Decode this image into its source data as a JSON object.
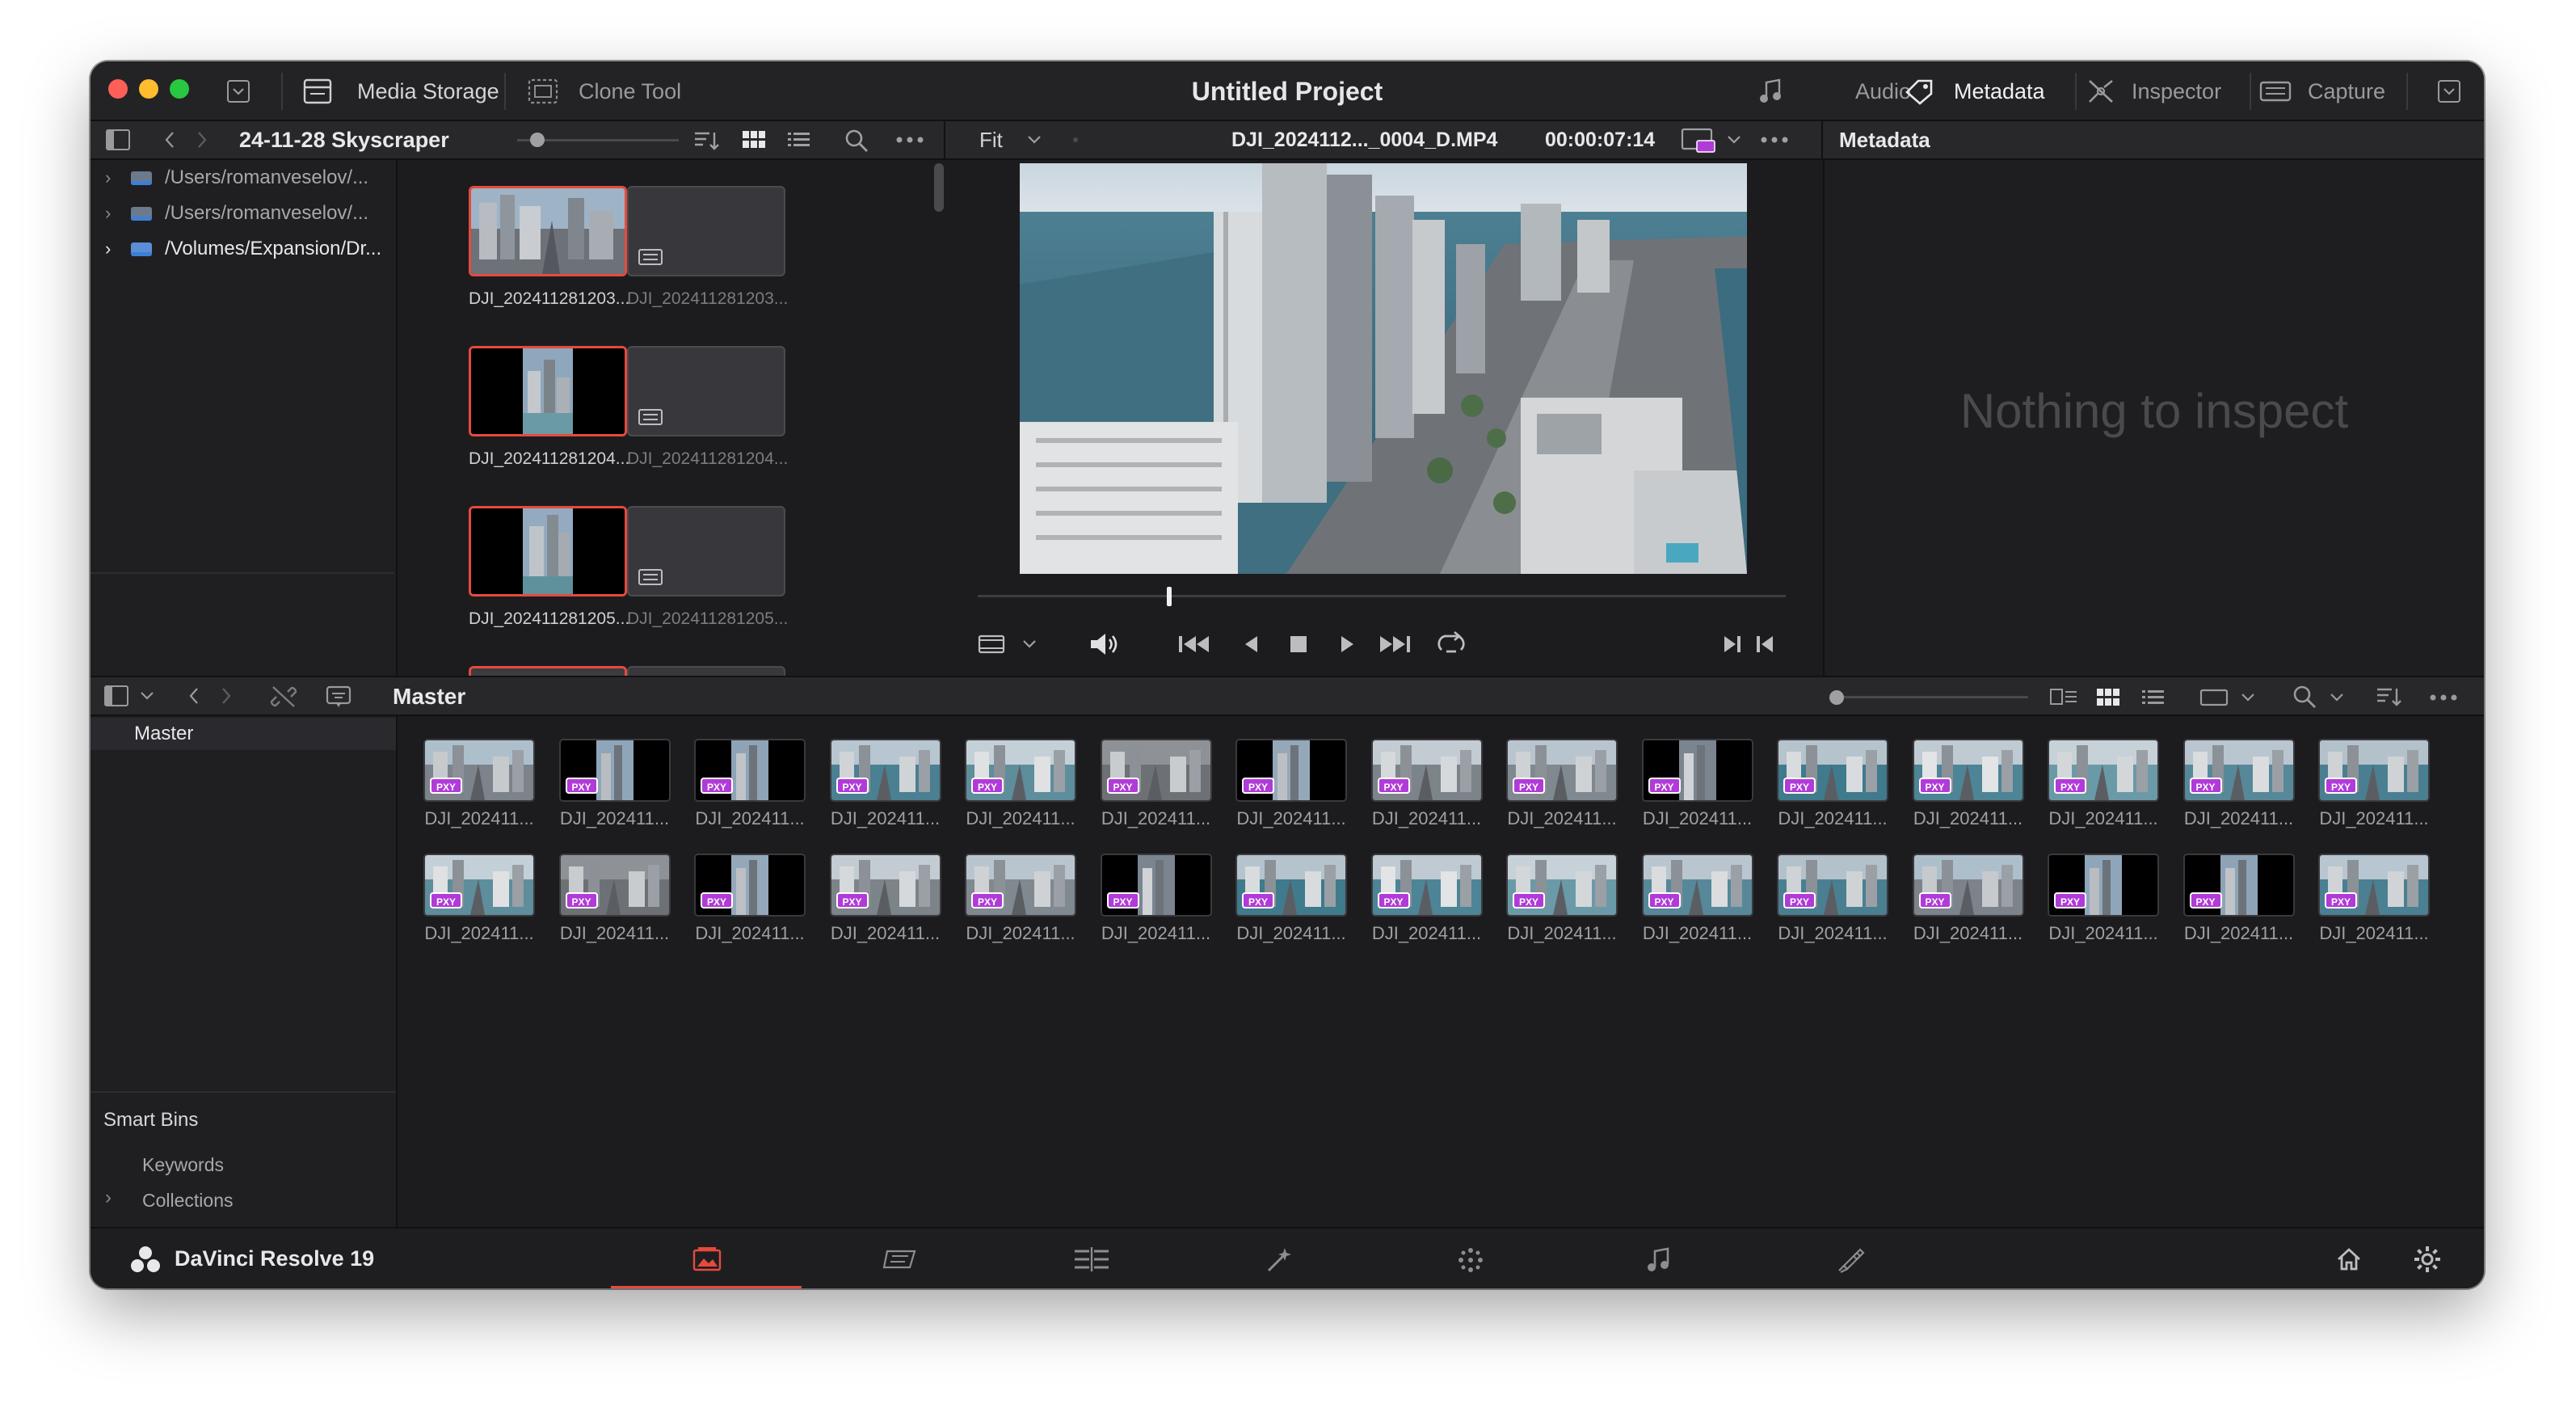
{
  "window": {
    "title": "Untitled Project",
    "traffic_lights": [
      "#ff5f57",
      "#febc2e",
      "#28c840"
    ]
  },
  "toolbar": {
    "media_storage_label": "Media Storage",
    "clone_tool_label": "Clone Tool",
    "audio_label": "Audio",
    "metadata_label": "Metadata",
    "inspector_label": "Inspector",
    "capture_label": "Capture"
  },
  "media_storage": {
    "bin_name": "24-11-28 Skyscraper",
    "locations": [
      {
        "label": "/Users/romanveselov/..."
      },
      {
        "label": "/Users/romanveselov/..."
      },
      {
        "label": "/Volumes/Expansion/Dr..."
      }
    ],
    "clips": [
      {
        "label": "DJI_202411281203...",
        "selected": true
      },
      {
        "label": "DJI_202411281203...",
        "selected": false
      },
      {
        "label": "DJI_202411281204...",
        "selected": true
      },
      {
        "label": "DJI_202411281204...",
        "selected": false
      },
      {
        "label": "DJI_202411281205...",
        "selected": true
      },
      {
        "label": "DJI_202411281205...",
        "selected": false
      }
    ]
  },
  "viewer": {
    "zoom": "Fit",
    "clip_name": "DJI_2024112..._0004_D.MP4",
    "timecode": "00:00:07:14",
    "playhead_fraction": 0.24
  },
  "metadata_panel": {
    "title": "Metadata",
    "empty_message": "Nothing to inspect"
  },
  "media_pool": {
    "bin_title": "Master",
    "sidebar_master": "Master",
    "smart_bins_label": "Smart Bins",
    "smart_bin_items": [
      "Keywords",
      "Collections"
    ],
    "clip_label": "DJI_202411...",
    "proxy_badge": "PXY",
    "clip_count": 30
  },
  "footer": {
    "app_name": "DaVinci Resolve 19",
    "pages": [
      "media-page",
      "cut-page",
      "edit-page",
      "fusion-page",
      "color-page",
      "fairlight-page",
      "deliver-page"
    ],
    "active_page": "media-page",
    "accent": "#e64a3c"
  }
}
